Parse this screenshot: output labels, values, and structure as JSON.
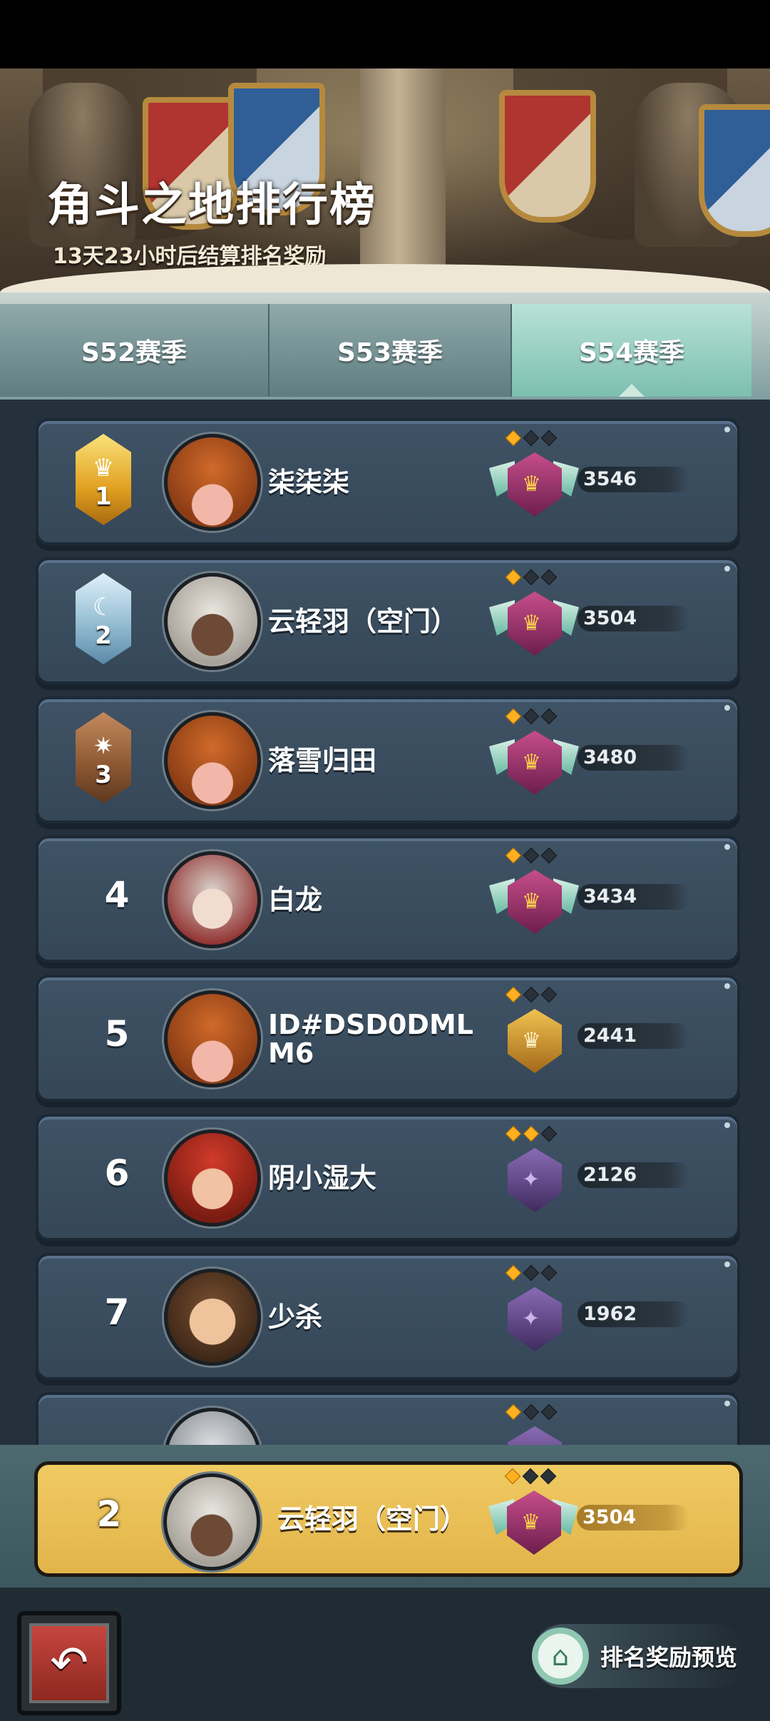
{
  "banner": {
    "title": "角斗之地排行榜",
    "subtitle": "13天23小时后结算排名奖励"
  },
  "tabs": [
    {
      "label": "S52赛季",
      "active": false
    },
    {
      "label": "S53赛季",
      "active": false
    },
    {
      "label": "S54赛季",
      "active": true
    }
  ],
  "rows": [
    {
      "rank": "1",
      "medal": "gold",
      "name": "柒柒柒",
      "score": "3546",
      "pips": 1,
      "tier": "master",
      "avatar": "pumpkin-avatar"
    },
    {
      "rank": "2",
      "medal": "silver",
      "name": "云轻羽（空门）",
      "score": "3504",
      "pips": 1,
      "tier": "master",
      "avatar": "white-hair-girl-avatar"
    },
    {
      "rank": "3",
      "medal": "bronze",
      "name": "落雪归田",
      "score": "3480",
      "pips": 1,
      "tier": "master",
      "avatar": "pumpkin-avatar"
    },
    {
      "rank": "4",
      "medal": "",
      "name": "白龙",
      "score": "3434",
      "pips": 1,
      "tier": "master",
      "avatar": "snowman-avatar"
    },
    {
      "rank": "5",
      "medal": "",
      "name": "ID#DSD0DMLM6",
      "score": "2441",
      "pips": 1,
      "tier": "gold",
      "avatar": "pumpkin-avatar"
    },
    {
      "rank": "6",
      "medal": "",
      "name": "阴小湿大",
      "score": "2126",
      "pips": 2,
      "tier": "purple",
      "avatar": "chief-avatar"
    },
    {
      "rank": "7",
      "medal": "",
      "name": "少杀",
      "score": "1962",
      "pips": 1,
      "tier": "purple",
      "avatar": "bald-man-avatar"
    }
  ],
  "my_rank": {
    "rank": "2",
    "name": "云轻羽（空门）",
    "score": "3504",
    "pips": 1,
    "tier": "master"
  },
  "footer": {
    "back_icon": "back-arrow-icon",
    "reward_label": "排名奖励预览",
    "reward_icon": "reward-chest-icon"
  },
  "colors": {
    "highlight": "#e8bd52",
    "row_bg": "#3a4d60",
    "active_tab": "#9fd3c4"
  }
}
